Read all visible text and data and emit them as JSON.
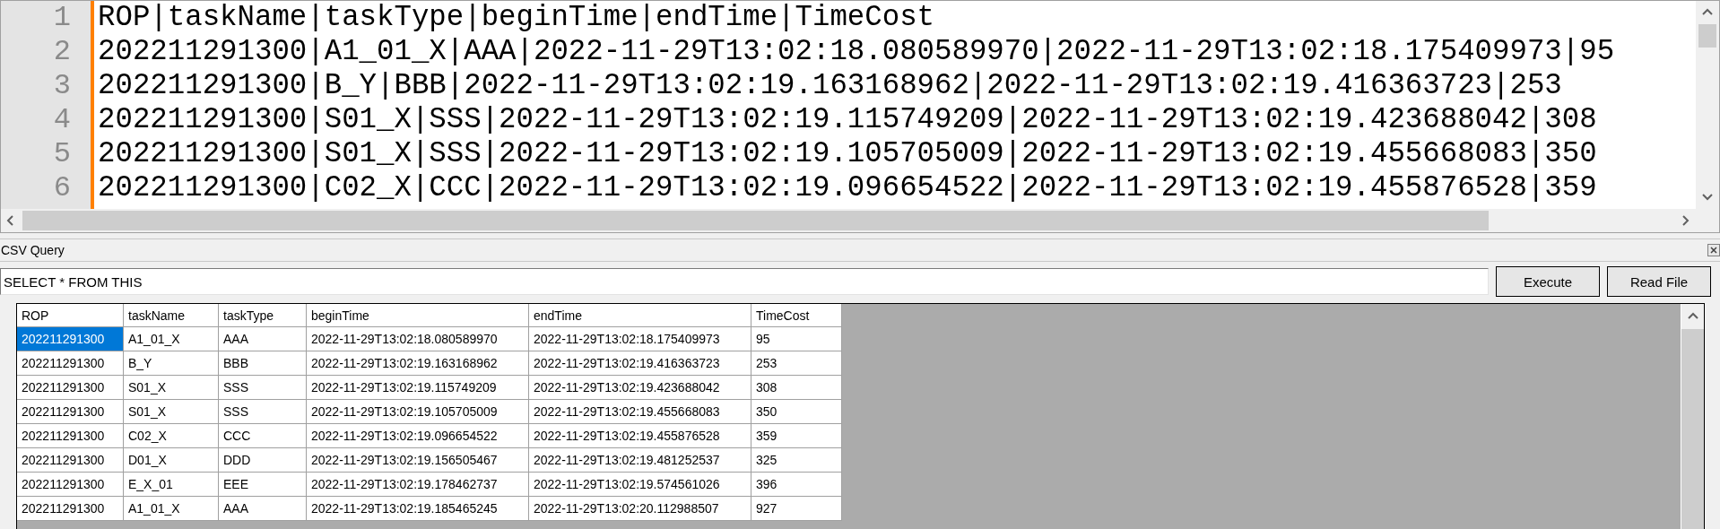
{
  "editor": {
    "lines": [
      {
        "number": "1",
        "text": "ROP|taskName|taskType|beginTime|endTime|TimeCost"
      },
      {
        "number": "2",
        "text": "202211291300|A1_01_X|AAA|2022-11-29T13:02:18.080589970|2022-11-29T13:02:18.175409973|95"
      },
      {
        "number": "3",
        "text": "202211291300|B_Y|BBB|2022-11-29T13:02:19.163168962|2022-11-29T13:02:19.416363723|253"
      },
      {
        "number": "4",
        "text": "202211291300|S01_X|SSS|2022-11-29T13:02:19.115749209|2022-11-29T13:02:19.423688042|308"
      },
      {
        "number": "5",
        "text": "202211291300|S01_X|SSS|2022-11-29T13:02:19.105705009|2022-11-29T13:02:19.455668083|350"
      },
      {
        "number": "6",
        "text": "202211291300|C02_X|CCC|2022-11-29T13:02:19.096654522|2022-11-29T13:02:19.455876528|359"
      }
    ]
  },
  "panel": {
    "title": "CSV Query",
    "query": {
      "value": "SELECT * FROM THIS"
    },
    "buttons": [
      "Execute",
      "Read File"
    ],
    "table": {
      "columns": [
        "ROP",
        "taskName",
        "taskType",
        "beginTime",
        "endTime",
        "TimeCost"
      ],
      "rows": [
        {
          "selected": true,
          "cells": [
            "202211291300",
            "A1_01_X",
            "AAA",
            "2022-11-29T13:02:18.080589970",
            "2022-11-29T13:02:18.175409973",
            "95"
          ]
        },
        {
          "selected": false,
          "cells": [
            "202211291300",
            "B_Y",
            "BBB",
            "2022-11-29T13:02:19.163168962",
            "2022-11-29T13:02:19.416363723",
            "253"
          ]
        },
        {
          "selected": false,
          "cells": [
            "202211291300",
            "S01_X",
            "SSS",
            "2022-11-29T13:02:19.115749209",
            "2022-11-29T13:02:19.423688042",
            "308"
          ]
        },
        {
          "selected": false,
          "cells": [
            "202211291300",
            "S01_X",
            "SSS",
            "2022-11-29T13:02:19.105705009",
            "2022-11-29T13:02:19.455668083",
            "350"
          ]
        },
        {
          "selected": false,
          "cells": [
            "202211291300",
            "C02_X",
            "CCC",
            "2022-11-29T13:02:19.096654522",
            "2022-11-29T13:02:19.455876528",
            "359"
          ]
        },
        {
          "selected": false,
          "cells": [
            "202211291300",
            "D01_X",
            "DDD",
            "2022-11-29T13:02:19.156505467",
            "2022-11-29T13:02:19.481252537",
            "325"
          ]
        },
        {
          "selected": false,
          "cells": [
            "202211291300",
            "E_X_01",
            "EEE",
            "2022-11-29T13:02:19.178462737",
            "2022-11-29T13:02:19.574561026",
            "396"
          ]
        },
        {
          "selected": false,
          "cells": [
            "202211291300",
            "A1_01_X",
            "AAA",
            "2022-11-29T13:02:19.185465245",
            "2022-11-29T13:02:20.112988507",
            "927"
          ]
        }
      ]
    }
  }
}
